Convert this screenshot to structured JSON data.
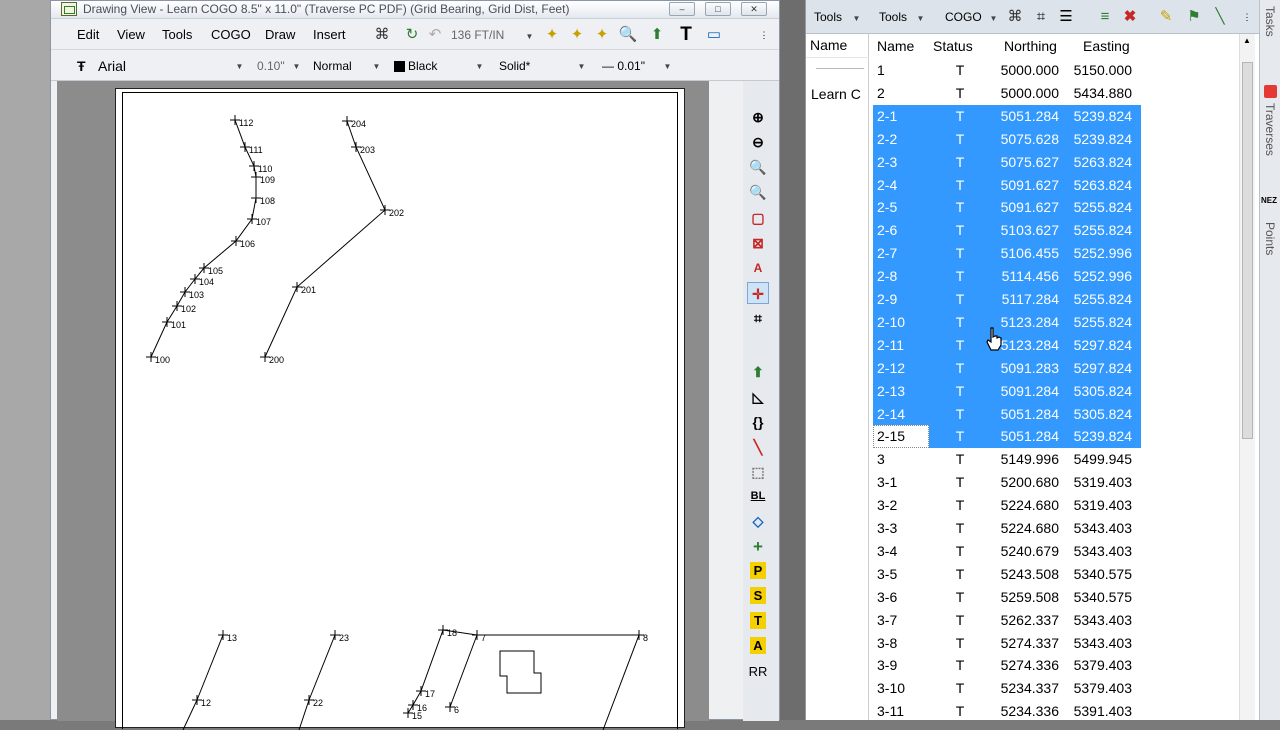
{
  "drawing_window": {
    "title": "Drawing View - Learn COGO  8.5\" x 11.0\" (Traverse PC PDF) (Grid Bearing, Grid Dist, Feet)",
    "controls": {
      "minimize": "–",
      "maximize": "□",
      "close": "✕"
    },
    "menu": [
      "Edit",
      "View",
      "Tools",
      "COGO",
      "Draw",
      "Insert"
    ],
    "scale": "136 FT/IN",
    "format": {
      "font": "Arial",
      "size": "0.10\"",
      "style": "Normal",
      "color_name": "Black",
      "line_type": "Solid*",
      "line_weight": "— 0.01\""
    },
    "right_tool_letters": {
      "bl": "BL",
      "p": "P",
      "s": "S",
      "t": "T",
      "a": "A",
      "r": "RR"
    },
    "plot": {
      "labels": [
        "112",
        "111",
        "110",
        "109",
        "108",
        "107",
        "106",
        "105",
        "104",
        "103",
        "102",
        "101",
        "100",
        "204",
        "203",
        "202",
        "201",
        "200",
        "13",
        "12",
        "23",
        "22",
        "18",
        "7",
        "8",
        "17",
        "16",
        "15",
        "6"
      ]
    }
  },
  "data_window": {
    "toolbar": {
      "tools1": "Tools",
      "tools2": "Tools",
      "cogo": "COGO"
    },
    "tree": {
      "header": "Name",
      "item": "Learn C"
    },
    "columns": [
      "Name",
      "Status",
      "Northing",
      "Easting"
    ],
    "rows": [
      {
        "name": "1",
        "status": "T",
        "northing": "5000.000",
        "easting": "5150.000",
        "selected": false
      },
      {
        "name": "2",
        "status": "T",
        "northing": "5000.000",
        "easting": "5434.880",
        "selected": false
      },
      {
        "name": "2-1",
        "status": "T",
        "northing": "5051.284",
        "easting": "5239.824",
        "selected": true
      },
      {
        "name": "2-2",
        "status": "T",
        "northing": "5075.628",
        "easting": "5239.824",
        "selected": true
      },
      {
        "name": "2-3",
        "status": "T",
        "northing": "5075.627",
        "easting": "5263.824",
        "selected": true
      },
      {
        "name": "2-4",
        "status": "T",
        "northing": "5091.627",
        "easting": "5263.824",
        "selected": true
      },
      {
        "name": "2-5",
        "status": "T",
        "northing": "5091.627",
        "easting": "5255.824",
        "selected": true
      },
      {
        "name": "2-6",
        "status": "T",
        "northing": "5103.627",
        "easting": "5255.824",
        "selected": true
      },
      {
        "name": "2-7",
        "status": "T",
        "northing": "5106.455",
        "easting": "5252.996",
        "selected": true
      },
      {
        "name": "2-8",
        "status": "T",
        "northing": "5114.456",
        "easting": "5252.996",
        "selected": true
      },
      {
        "name": "2-9",
        "status": "T",
        "northing": "5117.284",
        "easting": "5255.824",
        "selected": true
      },
      {
        "name": "2-10",
        "status": "T",
        "northing": "5123.284",
        "easting": "5255.824",
        "selected": true
      },
      {
        "name": "2-11",
        "status": "T",
        "northing": "5123.284",
        "easting": "5297.824",
        "selected": true
      },
      {
        "name": "2-12",
        "status": "T",
        "northing": "5091.283",
        "easting": "5297.824",
        "selected": true
      },
      {
        "name": "2-13",
        "status": "T",
        "northing": "5091.284",
        "easting": "5305.824",
        "selected": true
      },
      {
        "name": "2-14",
        "status": "T",
        "northing": "5051.284",
        "easting": "5305.824",
        "selected": true
      },
      {
        "name": "2-15",
        "status": "T",
        "northing": "5051.284",
        "easting": "5239.824",
        "selected": true,
        "focus": true
      },
      {
        "name": "3",
        "status": "T",
        "northing": "5149.996",
        "easting": "5499.945",
        "selected": false
      },
      {
        "name": "3-1",
        "status": "T",
        "northing": "5200.680",
        "easting": "5319.403",
        "selected": false
      },
      {
        "name": "3-2",
        "status": "T",
        "northing": "5224.680",
        "easting": "5319.403",
        "selected": false
      },
      {
        "name": "3-3",
        "status": "T",
        "northing": "5224.680",
        "easting": "5343.403",
        "selected": false
      },
      {
        "name": "3-4",
        "status": "T",
        "northing": "5240.679",
        "easting": "5343.403",
        "selected": false
      },
      {
        "name": "3-5",
        "status": "T",
        "northing": "5243.508",
        "easting": "5340.575",
        "selected": false
      },
      {
        "name": "3-6",
        "status": "T",
        "northing": "5259.508",
        "easting": "5340.575",
        "selected": false
      },
      {
        "name": "3-7",
        "status": "T",
        "northing": "5262.337",
        "easting": "5343.403",
        "selected": false
      },
      {
        "name": "3-8",
        "status": "T",
        "northing": "5274.337",
        "easting": "5343.403",
        "selected": false
      },
      {
        "name": "3-9",
        "status": "T",
        "northing": "5274.336",
        "easting": "5379.403",
        "selected": false
      },
      {
        "name": "3-10",
        "status": "T",
        "northing": "5234.337",
        "easting": "5379.403",
        "selected": false
      },
      {
        "name": "3-11",
        "status": "T",
        "northing": "5234.336",
        "easting": "5391.403",
        "selected": false
      }
    ],
    "side_tabs": [
      "Tasks",
      "Traverses",
      "Points"
    ],
    "side_tab_badge": "NEZ"
  },
  "colors": {
    "selection": "#3399ff",
    "selection_text": "#ffffff"
  }
}
